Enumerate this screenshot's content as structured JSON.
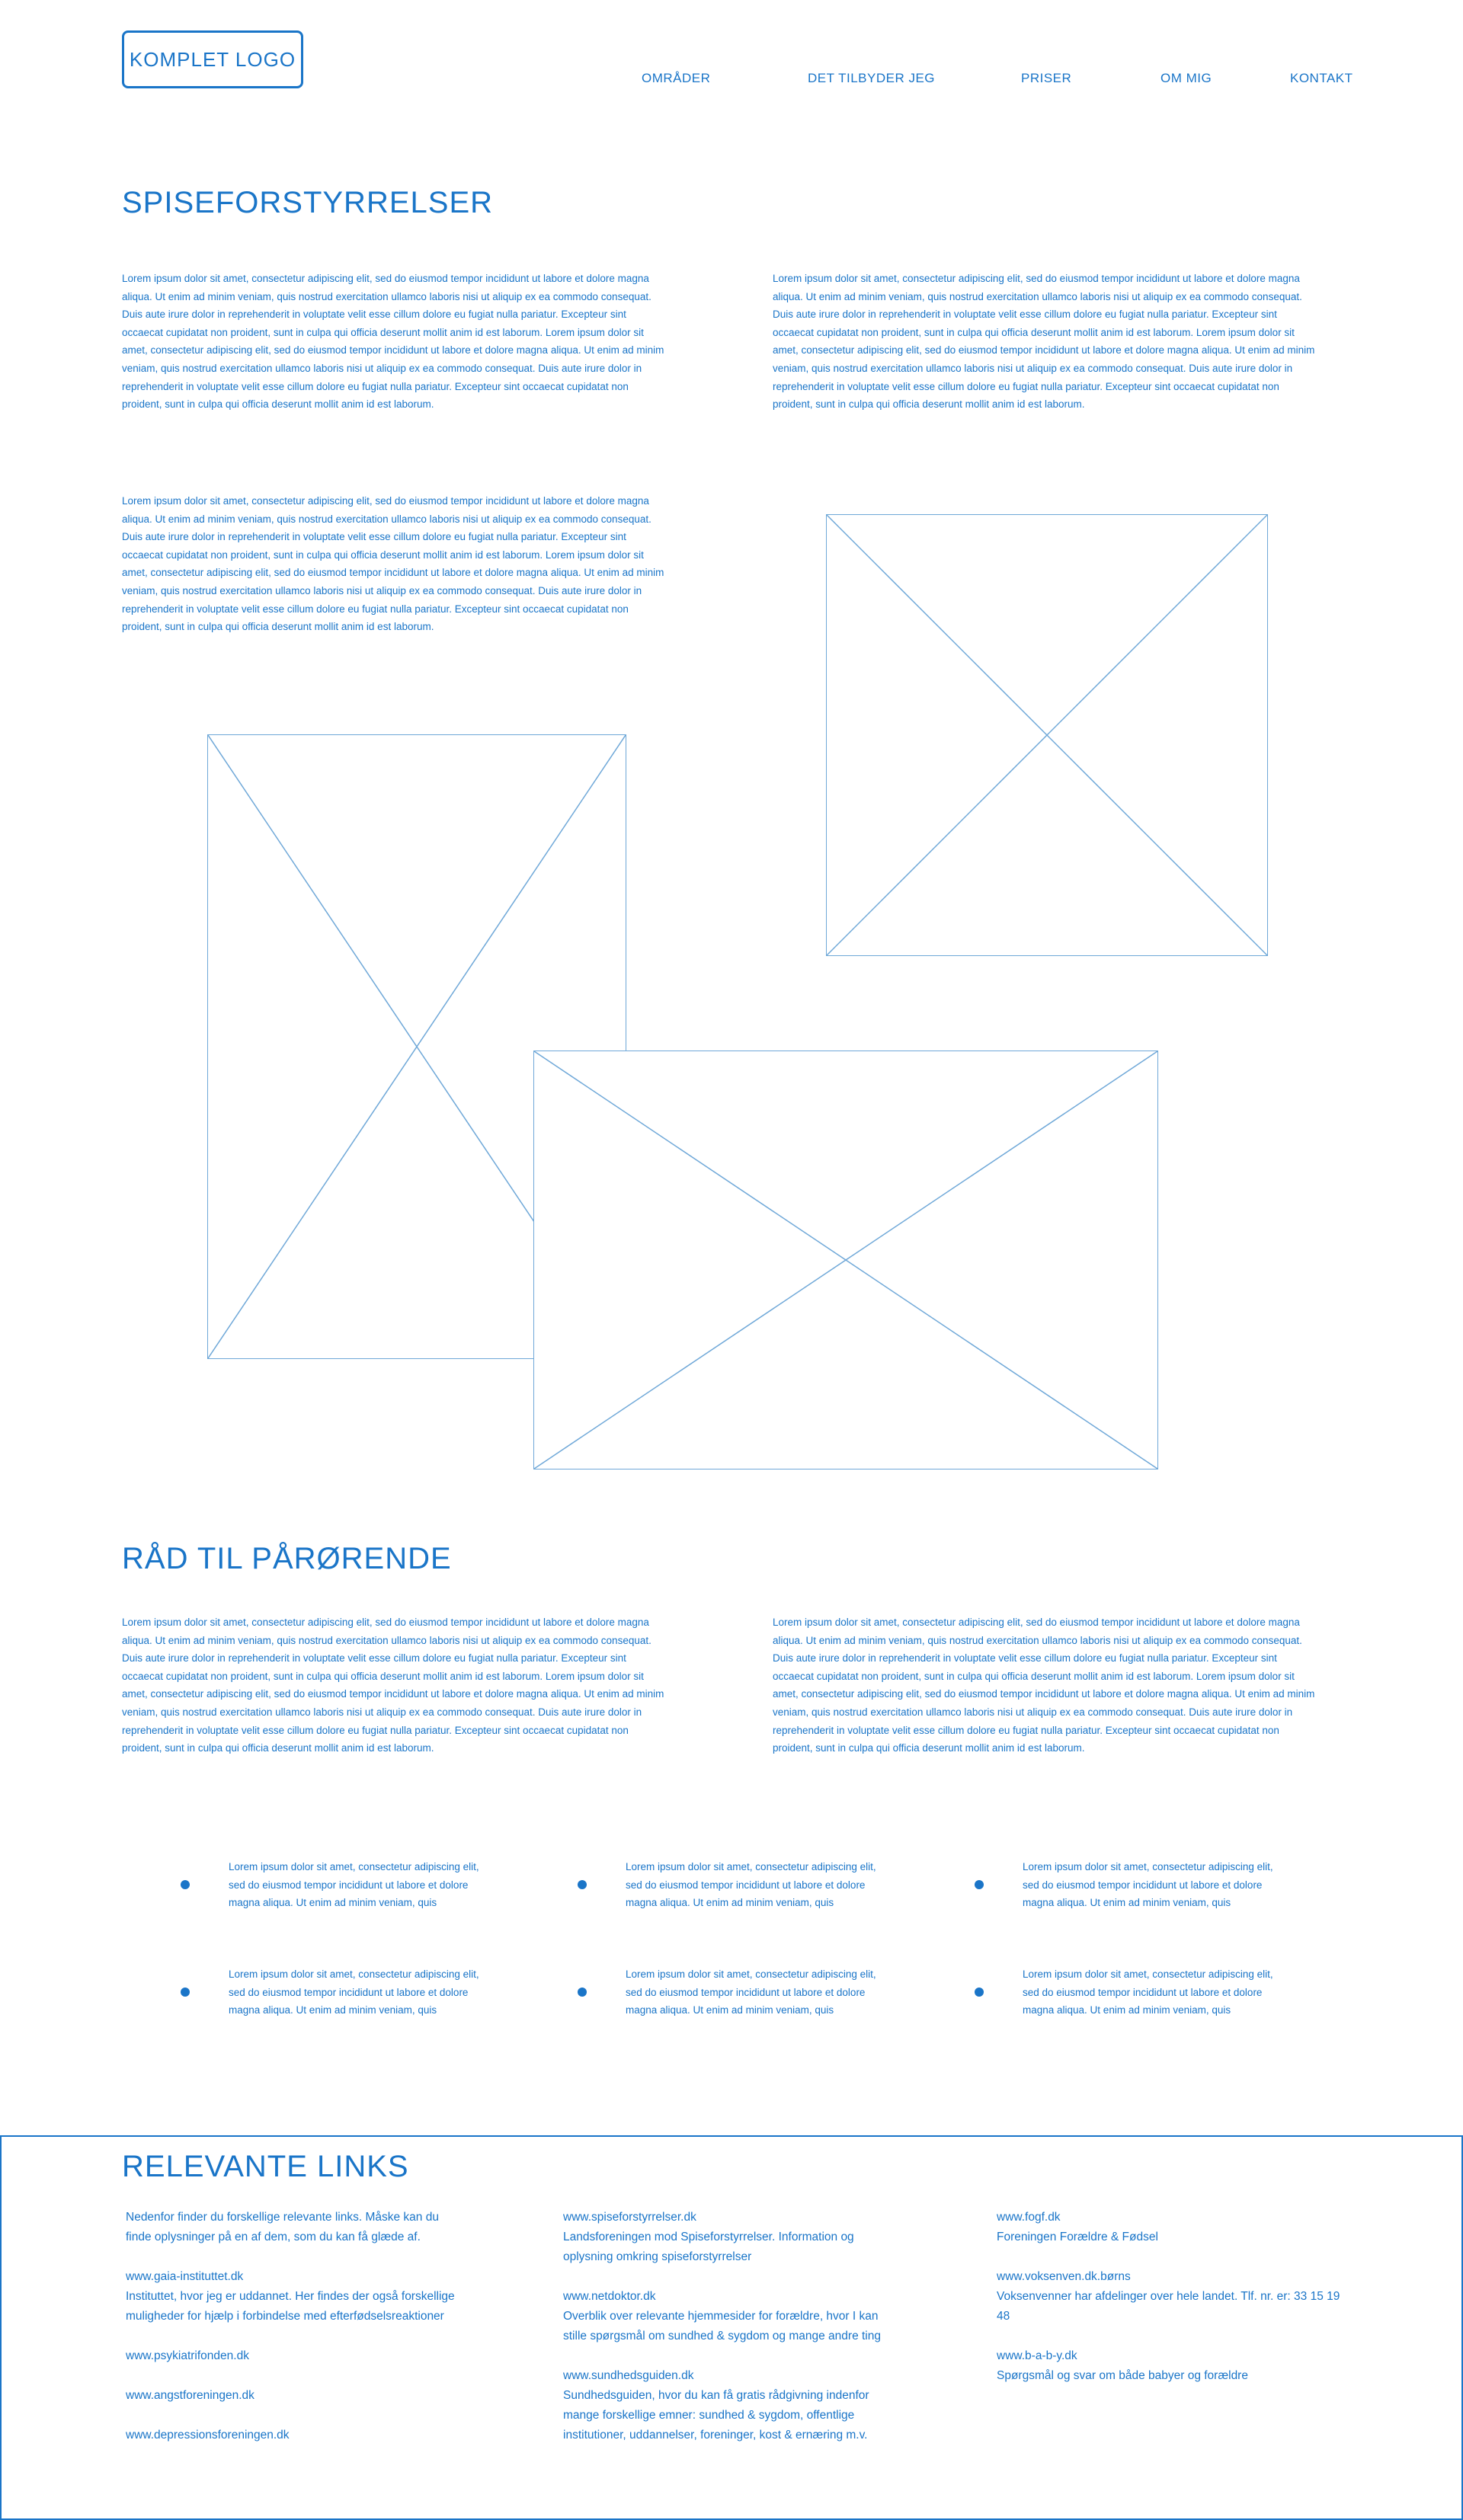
{
  "header": {
    "logo": "KOMPLET LOGO",
    "nav": [
      {
        "label": "OMRÅDER"
      },
      {
        "label": "DET TILBYDER JEG"
      },
      {
        "label": "PRISER"
      },
      {
        "label": "OM MIG"
      },
      {
        "label": "KONTAKT"
      }
    ]
  },
  "section1": {
    "title": "SPISEFORSTYRRELSER",
    "para_left": "Lorem ipsum dolor sit amet, consectetur adipiscing elit, sed do eiusmod tempor incididunt ut labore et dolore magna aliqua. Ut enim ad minim veniam, quis nostrud exercitation ullamco laboris nisi ut aliquip ex ea commodo consequat. Duis aute irure dolor in reprehenderit in voluptate velit esse cillum dolore eu fugiat nulla pariatur. Excepteur sint occaecat cupidatat non proident, sunt in culpa qui officia deserunt mollit anim id est laborum. Lorem ipsum dolor sit amet, consectetur adipiscing elit, sed do eiusmod tempor incididunt ut labore et dolore magna aliqua. Ut enim ad minim veniam, quis nostrud exercitation ullamco laboris nisi ut aliquip ex ea commodo consequat. Duis aute irure dolor in reprehenderit in voluptate velit esse cillum dolore eu fugiat nulla pariatur. Excepteur sint occaecat cupidatat non proident, sunt in culpa qui officia deserunt mollit anim id est laborum.",
    "para_right": "Lorem ipsum dolor sit amet, consectetur adipiscing elit, sed do eiusmod tempor incididunt ut labore et dolore magna aliqua. Ut enim ad minim veniam, quis nostrud exercitation ullamco laboris nisi ut aliquip ex ea commodo consequat. Duis aute irure dolor in reprehenderit in voluptate velit esse cillum dolore eu fugiat nulla pariatur. Excepteur sint occaecat cupidatat non proident, sunt in culpa qui officia deserunt mollit anim id est laborum. Lorem ipsum dolor sit amet, consectetur adipiscing elit, sed do eiusmod tempor incididunt ut labore et dolore magna aliqua. Ut enim ad minim veniam, quis nostrud exercitation ullamco laboris nisi ut aliquip ex ea commodo consequat. Duis aute irure dolor in reprehenderit in voluptate velit esse cillum dolore eu fugiat nulla pariatur. Excepteur sint occaecat cupidatat non proident, sunt in culpa qui officia deserunt mollit anim id est laborum.",
    "para_third": "Lorem ipsum dolor sit amet, consectetur adipiscing elit, sed do eiusmod tempor incididunt ut labore et dolore magna aliqua. Ut enim ad minim veniam, quis nostrud exercitation ullamco laboris nisi ut aliquip ex ea commodo consequat. Duis aute irure dolor in reprehenderit in voluptate velit esse cillum dolore eu fugiat nulla pariatur. Excepteur sint occaecat cupidatat non proident, sunt in culpa qui officia deserunt mollit anim id est laborum. Lorem ipsum dolor sit amet, consectetur adipiscing elit, sed do eiusmod tempor incididunt ut labore et dolore magna aliqua. Ut enim ad minim veniam, quis nostrud exercitation ullamco laboris nisi ut aliquip ex ea commodo consequat. Duis aute irure dolor in reprehenderit in voluptate velit esse cillum dolore eu fugiat nulla pariatur. Excepteur sint occaecat cupidatat non proident, sunt in culpa qui officia deserunt mollit anim id est laborum."
  },
  "section2": {
    "title": "RÅD TIL PÅRØRENDE",
    "para_left": "Lorem ipsum dolor sit amet, consectetur adipiscing elit, sed do eiusmod tempor incididunt ut labore et dolore magna aliqua. Ut enim ad minim veniam, quis nostrud exercitation ullamco laboris nisi ut aliquip ex ea commodo consequat. Duis aute irure dolor in reprehenderit in voluptate velit esse cillum dolore eu fugiat nulla pariatur. Excepteur sint occaecat cupidatat non proident, sunt in culpa qui officia deserunt mollit anim id est laborum. Lorem ipsum dolor sit amet, consectetur adipiscing elit, sed do eiusmod tempor incididunt ut labore et dolore magna aliqua. Ut enim ad minim veniam, quis nostrud exercitation ullamco laboris nisi ut aliquip ex ea commodo consequat. Duis aute irure dolor in reprehenderit in voluptate velit esse cillum dolore eu fugiat nulla pariatur. Excepteur sint occaecat cupidatat non proident, sunt in culpa qui officia deserunt mollit anim id est laborum.",
    "para_right": "Lorem ipsum dolor sit amet, consectetur adipiscing elit, sed do eiusmod tempor incididunt ut labore et dolore magna aliqua. Ut enim ad minim veniam, quis nostrud exercitation ullamco laboris nisi ut aliquip ex ea commodo consequat. Duis aute irure dolor in reprehenderit in voluptate velit esse cillum dolore eu fugiat nulla pariatur. Excepteur sint occaecat cupidatat non proident, sunt in culpa qui officia deserunt mollit anim id est laborum. Lorem ipsum dolor sit amet, consectetur adipiscing elit, sed do eiusmod tempor incididunt ut labore et dolore magna aliqua. Ut enim ad minim veniam, quis nostrud exercitation ullamco laboris nisi ut aliquip ex ea commodo consequat. Duis aute irure dolor in reprehenderit in voluptate velit esse cillum dolore eu fugiat nulla pariatur. Excepteur sint occaecat cupidatat non proident, sunt in culpa qui officia deserunt mollit anim id est laborum.",
    "bullets": [
      "Lorem ipsum dolor sit amet, consectetur adipiscing elit, sed do eiusmod tempor incididunt ut labore et dolore magna aliqua. Ut enim ad minim veniam, quis",
      "Lorem ipsum dolor sit amet, consectetur adipiscing elit, sed do eiusmod tempor incididunt ut labore et dolore magna aliqua. Ut enim ad minim veniam, quis",
      "Lorem ipsum dolor sit amet, consectetur adipiscing elit, sed do eiusmod tempor incididunt ut labore et dolore magna aliqua. Ut enim ad minim veniam, quis",
      "Lorem ipsum dolor sit amet, consectetur adipiscing elit, sed do eiusmod tempor incididunt ut labore et dolore magna aliqua. Ut enim ad minim veniam, quis",
      "Lorem ipsum dolor sit amet, consectetur adipiscing elit, sed do eiusmod tempor incididunt ut labore et dolore magna aliqua. Ut enim ad minim veniam, quis",
      "Lorem ipsum dolor sit amet, consectetur adipiscing elit, sed do eiusmod tempor incididunt ut labore et dolore magna aliqua. Ut enim ad minim veniam, quis"
    ]
  },
  "links": {
    "title": "RELEVANTE LINKS",
    "intro": "Nedenfor finder du forskellige relevante links. Måske kan du finde oplysninger på en af dem, som du kan få glæde af.",
    "col1": [
      {
        "url": "www.gaia-instituttet.dk",
        "desc": "Instituttet, hvor jeg er uddannet. Her findes der også forskellige muligheder for hjælp i forbindelse med efterfødselsreaktioner"
      },
      {
        "url": "www.psykiatrifonden.dk",
        "desc": ""
      },
      {
        "url": "www.angstforeningen.dk",
        "desc": ""
      },
      {
        "url": "www.depressionsforeningen.dk",
        "desc": ""
      }
    ],
    "col2": [
      {
        "url": "www.spiseforstyrrelser.dk",
        "desc": "Landsforeningen mod Spiseforstyrrelser. Information og oplysning omkring spiseforstyrrelser"
      },
      {
        "url": "www.netdoktor.dk",
        "desc": "Overblik over relevante hjemmesider for forældre, hvor I kan stille spørgsmål om sundhed & sygdom og mange andre ting"
      },
      {
        "url": "www.sundhedsguiden.dk",
        "desc": "Sundhedsguiden, hvor du kan få gratis rådgivning indenfor mange forskellige emner: sundhed & sygdom, offentlige institutioner, uddannelser, foreninger, kost & ernæring m.v."
      }
    ],
    "col3": [
      {
        "url": "www.fogf.dk",
        "desc": "Foreningen Forældre & Fødsel"
      },
      {
        "url": "www.voksenven.dk.børns",
        "desc": "Voksenvenner har afdelinger over hele landet. Tlf. nr. er: 33 15 19 48"
      },
      {
        "url": "www.b-a-b-y.dk",
        "desc": "Spørgsmål og svar om både babyer og forældre"
      }
    ]
  },
  "colors": {
    "accent": "#1a75c8",
    "placeholder_stroke": "#6fa8d8"
  }
}
